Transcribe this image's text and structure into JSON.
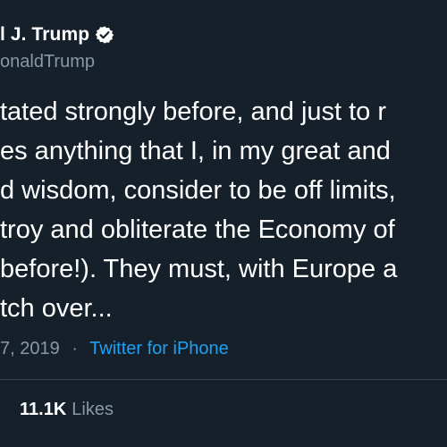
{
  "author": {
    "name_visible": "l J. Trump",
    "handle_visible": "onaldTrump",
    "verified_icon": "verified-badge-icon"
  },
  "body_lines": [
    "tated strongly before, and just to r",
    "es anything that I, in my great and",
    "d wisdom, consider to be off limits,",
    "troy and obliterate the Economy of",
    "before!). They must, with Europe a",
    "tch over..."
  ],
  "meta": {
    "date_visible": "7, 2019",
    "separator": "·",
    "source": "Twitter for iPhone"
  },
  "stats": {
    "likes_count": "11.1K",
    "likes_label": "Likes"
  },
  "colors": {
    "background": "#15202b",
    "text": "#ffffff",
    "secondary_text": "#8899a6",
    "link": "#1da1f2",
    "divider": "#38444d"
  }
}
